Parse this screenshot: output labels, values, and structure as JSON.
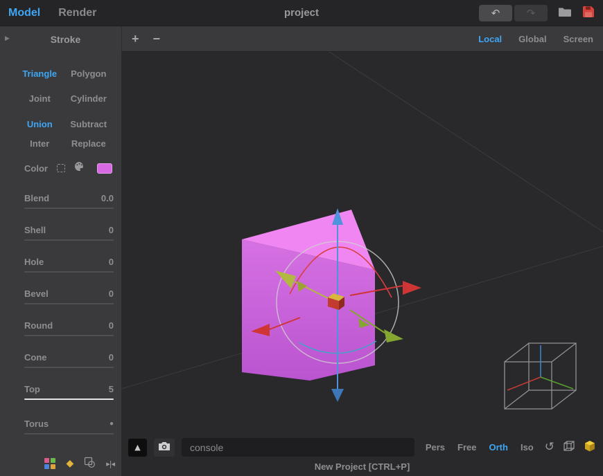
{
  "topbar": {
    "tabs": [
      {
        "label": "Model",
        "active": true
      },
      {
        "label": "Render",
        "active": false
      }
    ],
    "title": "project",
    "icons": {
      "undo": "↶",
      "redo": "↷"
    }
  },
  "sidebar": {
    "collapse_icon": "▶",
    "header": "Stroke",
    "shapes": [
      {
        "label": "Triangle",
        "active": true
      },
      {
        "label": "Polygon",
        "active": false
      },
      {
        "label": "Joint",
        "active": false
      },
      {
        "label": "Cylinder",
        "active": false
      }
    ],
    "booleans": [
      {
        "label": "Union",
        "active": true
      },
      {
        "label": "Subtract",
        "active": false
      },
      {
        "label": "Inter",
        "active": false
      },
      {
        "label": "Replace",
        "active": false
      }
    ],
    "color": {
      "label": "Color",
      "value": "#d76ae3"
    },
    "sliders": [
      {
        "label": "Blend",
        "value": "0.0"
      },
      {
        "label": "Shell",
        "value": "0"
      },
      {
        "label": "Hole",
        "value": "0"
      },
      {
        "label": "Bevel",
        "value": "0"
      },
      {
        "label": "Round",
        "value": "0"
      },
      {
        "label": "Cone",
        "value": "0"
      },
      {
        "label": "Top",
        "value": "5"
      },
      {
        "label": "Torus",
        "value": "●"
      }
    ],
    "footer": {
      "diamond": "◆",
      "mirror": "▸|◂"
    }
  },
  "viewport": {
    "zoom_in": "+",
    "zoom_out": "−",
    "space_modes": [
      {
        "label": "Local",
        "active": true
      },
      {
        "label": "Global",
        "active": false
      },
      {
        "label": "Screen",
        "active": false
      }
    ],
    "console": {
      "placeholder": "console"
    },
    "trigger": "▲",
    "view_modes": [
      {
        "label": "Pers",
        "active": false
      },
      {
        "label": "Free",
        "active": false
      },
      {
        "label": "Orth",
        "active": true
      },
      {
        "label": "Iso",
        "active": false
      }
    ],
    "icons": {
      "rotate_reset": "↺"
    }
  },
  "statusbar": {
    "text": "New Project [CTRL+P]"
  },
  "colors": {
    "accent_blue": "#3ea6f2",
    "shape_front": "#c766da",
    "shape_top": "#ef86f2",
    "save_red": "#d5433c",
    "gizmo_red": "#cf3535",
    "gizmo_green": "#85a631",
    "gizmo_blue": "#4f93dd",
    "gizmo_yellow": "#b3b840"
  }
}
